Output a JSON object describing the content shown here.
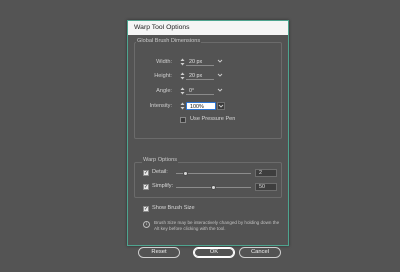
{
  "dialog": {
    "title": "Warp Tool Options",
    "brush_group": {
      "label": "Global Brush Dimensions",
      "width": {
        "label": "Width:",
        "value": "20 px"
      },
      "height": {
        "label": "Height:",
        "value": "20 px"
      },
      "angle": {
        "label": "Angle:",
        "value": "0°"
      },
      "intensity": {
        "label": "Intensity:",
        "value": "100%"
      },
      "pressure_pen": {
        "label": "Use Pressure Pen",
        "checked": false
      }
    },
    "warp_group": {
      "label": "Warp Options",
      "detail": {
        "label": "Detail:",
        "checked": true,
        "value": "2",
        "slider_fraction": 0.12
      },
      "simplify": {
        "label": "Simplify:",
        "checked": true,
        "value": "50",
        "slider_fraction": 0.5
      }
    },
    "show_brush_size": {
      "label": "Show Brush Size",
      "checked": true
    },
    "info": "Brush Size may be interactively changed by holding down the Alt key before clicking with the tool.",
    "buttons": {
      "reset": "Reset",
      "ok": "OK",
      "cancel": "Cancel"
    },
    "icons": {
      "spinner": "up-down-arrows",
      "dropdown": "chevron-down",
      "info": "info-circle"
    },
    "colors": {
      "dialog_bg": "#535353",
      "accent_border": "#4ea48f",
      "focus": "#2d77d6"
    }
  }
}
